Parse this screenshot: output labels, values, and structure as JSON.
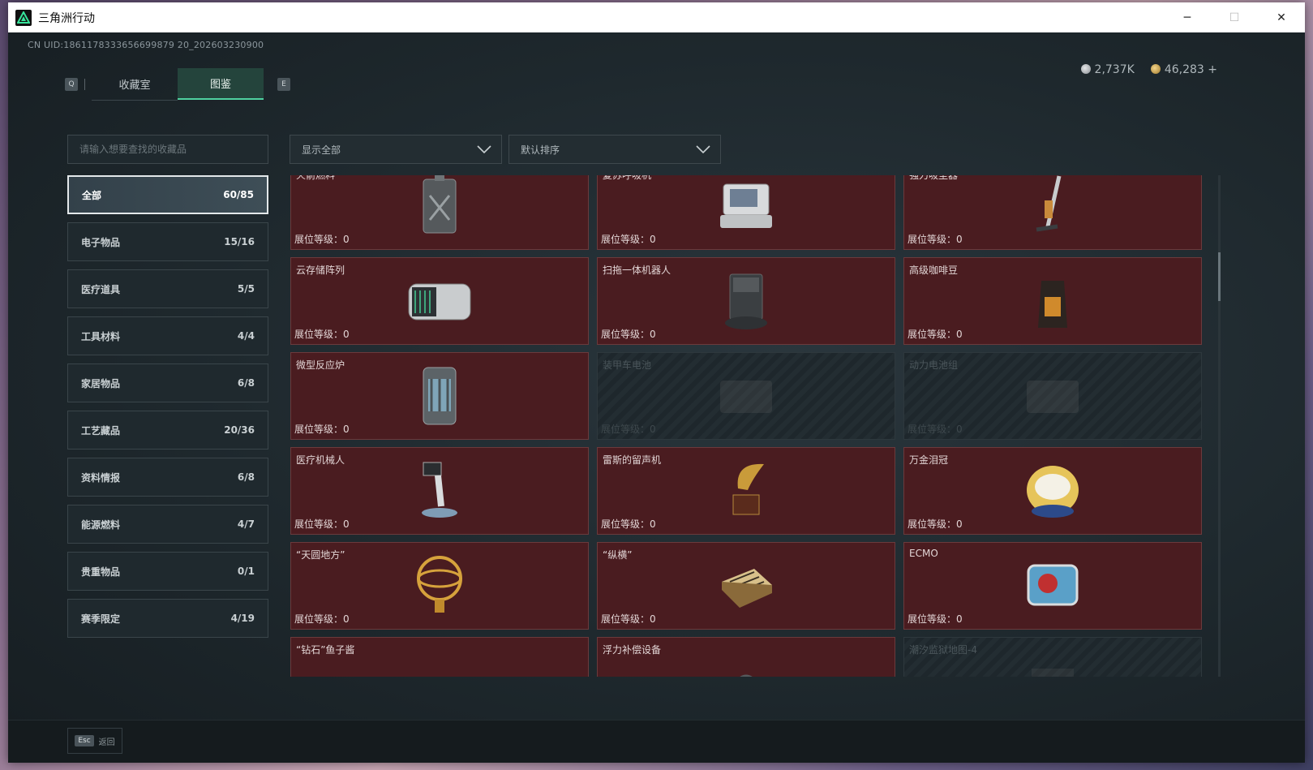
{
  "window": {
    "title": "三角洲行动",
    "min_label": "─",
    "max_label": "☐",
    "close_label": "✕"
  },
  "uid": "CN UID:1861178333656699879 20_202603230900",
  "tabs": {
    "left_key": "Q",
    "right_key": "E",
    "items": [
      {
        "label": "收藏室"
      },
      {
        "label": "图鉴"
      }
    ]
  },
  "currency": {
    "silver": "2,737K",
    "gold": "46,283",
    "add": "+"
  },
  "search": {
    "placeholder": "请输入想要查找的收藏品"
  },
  "filter": {
    "value": "显示全部"
  },
  "sort": {
    "value": "默认排序"
  },
  "categories": [
    {
      "label": "全部",
      "count": "60/85"
    },
    {
      "label": "电子物品",
      "count": "15/16"
    },
    {
      "label": "医疗道具",
      "count": "5/5"
    },
    {
      "label": "工具材料",
      "count": "4/4"
    },
    {
      "label": "家居物品",
      "count": "6/8"
    },
    {
      "label": "工艺藏品",
      "count": "20/36"
    },
    {
      "label": "资料情报",
      "count": "6/8"
    },
    {
      "label": "能源燃料",
      "count": "4/7"
    },
    {
      "label": "贵重物品",
      "count": "0/1"
    },
    {
      "label": "赛季限定",
      "count": "4/19"
    }
  ],
  "level_label": "展位等级：",
  "items": [
    {
      "name": "火箭燃料",
      "level": "0",
      "icon": "jerrycan-icon",
      "locked": false
    },
    {
      "name": "复苏呼吸机",
      "level": "0",
      "icon": "ventilator-icon",
      "locked": false
    },
    {
      "name": "强力吸尘器",
      "level": "0",
      "icon": "vacuum-icon",
      "locked": false
    },
    {
      "name": "云存储阵列",
      "level": "0",
      "icon": "storage-array-icon",
      "locked": false
    },
    {
      "name": "扫拖一体机器人",
      "level": "0",
      "icon": "robot-vacuum-icon",
      "locked": false
    },
    {
      "name": "高级咖啡豆",
      "level": "0",
      "icon": "coffee-bag-icon",
      "locked": false
    },
    {
      "name": "微型反应炉",
      "level": "0",
      "icon": "reactor-icon",
      "locked": false
    },
    {
      "name": "装甲车电池",
      "level": "0",
      "icon": "battery-icon",
      "locked": true
    },
    {
      "name": "动力电池组",
      "level": "0",
      "icon": "battery-pack-icon",
      "locked": true
    },
    {
      "name": "医疗机械人",
      "level": "0",
      "icon": "medical-robot-icon",
      "locked": false
    },
    {
      "name": "雷斯的留声机",
      "level": "0",
      "icon": "gramophone-icon",
      "locked": false
    },
    {
      "name": "万金泪冠",
      "level": "0",
      "icon": "jeweled-egg-icon",
      "locked": false
    },
    {
      "name": "“天圆地方”",
      "level": "0",
      "icon": "armillary-icon",
      "locked": false
    },
    {
      "name": "“纵横”",
      "level": "0",
      "icon": "chess-board-icon",
      "locked": false
    },
    {
      "name": "ECMO",
      "level": "0",
      "icon": "ecmo-icon",
      "locked": false
    },
    {
      "name": "“钻石”鱼子酱",
      "level": "",
      "icon": "caviar-tin-icon",
      "locked": false
    },
    {
      "name": "浮力补偿设备",
      "level": "",
      "icon": "diving-gear-icon",
      "locked": false
    },
    {
      "name": "潮汐监狱地图-4",
      "level": "",
      "icon": "map-icon",
      "locked": true
    }
  ],
  "footer": {
    "esc_key": "Esc",
    "back_label": "返回"
  },
  "colors": {
    "accent": "#4fd1a0",
    "card_bg": "#4a1c20",
    "card_locked_bg": "#1e272c"
  }
}
